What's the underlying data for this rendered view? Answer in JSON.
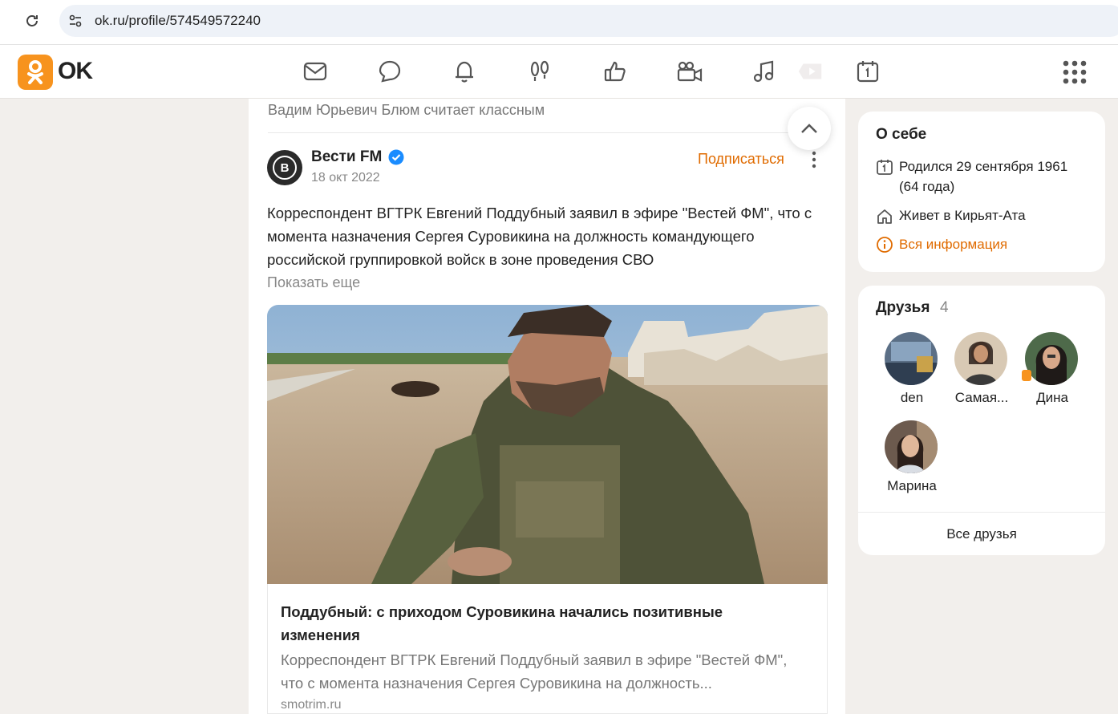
{
  "browser": {
    "url": "ok.ru/profile/574549572240"
  },
  "header": {
    "logo_text": "OK",
    "nav_icons": [
      "mail-icon",
      "chat-icon",
      "bell-icon",
      "guests-icon",
      "like-icon",
      "camera-icon",
      "music-icon",
      "video-icon",
      "calendar-icon"
    ],
    "apps_icon": "apps-grid-icon",
    "brand_color": "#f7931e"
  },
  "feed": {
    "liked_by": "Вадим Юрьевич Блюм считает классным",
    "post": {
      "author_initial": "В",
      "author": "Вести FM",
      "date": "18 окт 2022",
      "subscribe_label": "Подписаться",
      "text": "Корреспондент ВГТРК Евгений Поддубный заявил в эфире \"Вестей ФМ\", что с момента назначения Сергея Суровикина на должность командующего российской группировкой войск в зоне проведения СВО",
      "show_more": "Показать еще",
      "link": {
        "title": "Поддубный: с приходом Суровикина начались позитивные изменения",
        "description": "Корреспондент ВГТРК Евгений Поддубный заявил в эфире \"Вестей ФМ\", что с момента назначения Сергея Суровикина на должность...",
        "source": "smotrim.ru"
      }
    }
  },
  "about": {
    "title": "О себе",
    "born_line1": "Родился 29 сентября 1961",
    "born_line2": "(64 года)",
    "lives": "Живет в Кирьят-Ата",
    "all_info": "Вся информация"
  },
  "friends": {
    "title": "Друзья",
    "count": "4",
    "items": [
      {
        "name": "den"
      },
      {
        "name": "Самая..."
      },
      {
        "name": "Дина"
      },
      {
        "name": "Марина"
      }
    ],
    "all_label": "Все друзья"
  },
  "colors": {
    "accent": "#e06b00",
    "verified": "#1a8cff"
  }
}
